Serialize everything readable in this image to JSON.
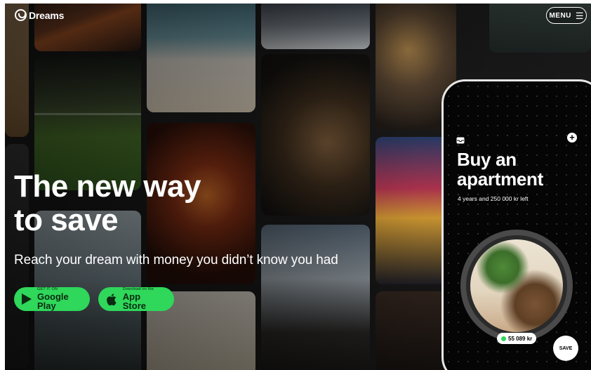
{
  "header": {
    "logo_text": "Dreams",
    "menu_label": "MENU",
    "menu_icon": "hamburger-icon"
  },
  "hero": {
    "headline_line1": "The new way",
    "headline_line2": "to save",
    "subheadline": "Reach your dream with money you didn’t know you had"
  },
  "store_buttons": {
    "google_play": {
      "small": "GET IT ON",
      "big": "Google Play",
      "icon": "google-play-icon"
    },
    "app_store": {
      "small": "Download on the",
      "big": "App Store",
      "icon": "apple-icon"
    }
  },
  "phone": {
    "title_line1": "Buy an",
    "title_line2": "apartment",
    "subtitle": "4 years and 250 000 kr left",
    "plus": "+",
    "amount": "55 089 kr",
    "save_label": "SAVE"
  },
  "colors": {
    "accent_green": "#2fd75a",
    "text_white": "#ffffff"
  }
}
